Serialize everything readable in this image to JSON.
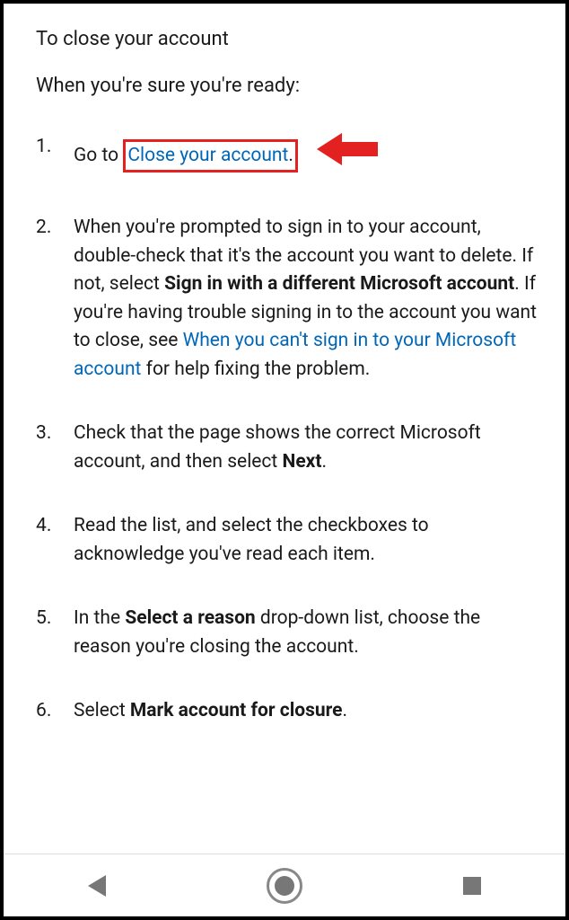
{
  "heading": "To close your account",
  "intro": "When you're sure you're ready:",
  "colors": {
    "link": "#0067b8",
    "highlight_border": "#e42121",
    "arrow": "#e42121",
    "nav_icon": "#777"
  },
  "step1": {
    "prefix": "Go to ",
    "link": "Close your account",
    "suffix": "."
  },
  "step2": {
    "part1": "When you're prompted to sign in to your account, double-check that it's the account you want to delete. If not, select ",
    "bold1": "Sign in with a different Microsoft account",
    "part2": ". If you're having trouble signing in to the account you want to close, see ",
    "link": "When you can't sign in to your Microsoft account",
    "part3": " for help fixing the problem."
  },
  "step3": {
    "part1": "Check that the page shows the correct Microsoft account, and then select ",
    "bold1": "Next",
    "part2": "."
  },
  "step4": {
    "text": "Read the list, and select the checkboxes to acknowledge you've read each item."
  },
  "step5": {
    "part1": "In the ",
    "bold1": "Select a reason",
    "part2": " drop-down list, choose the reason you're closing the account."
  },
  "step6": {
    "part1": "Select ",
    "bold1": "Mark account for closure",
    "part2": "."
  }
}
